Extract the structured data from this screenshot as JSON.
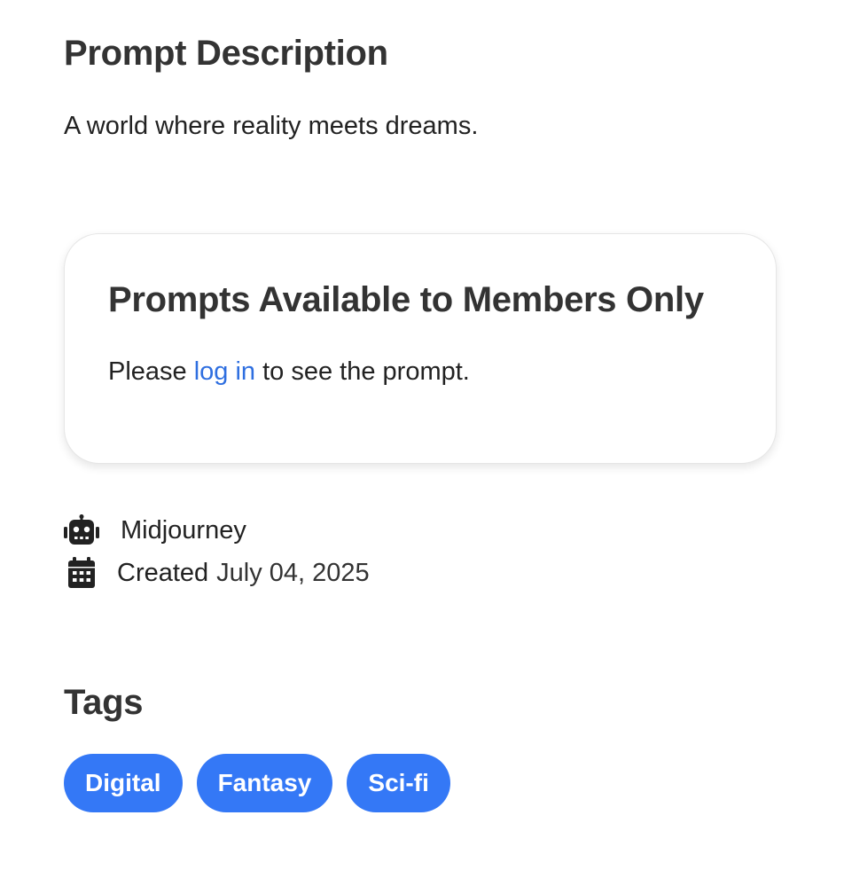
{
  "description": {
    "title": "Prompt Description",
    "text": "A world where reality meets dreams."
  },
  "members_card": {
    "title": "Prompts Available to Members Only",
    "text_before": "Please ",
    "link_label": "log in",
    "text_after": " to see the prompt."
  },
  "meta": {
    "model_icon": "robot-icon",
    "model": "Midjourney",
    "created_icon": "calendar-icon",
    "created_label": "Created",
    "created_date": "July 04, 2025"
  },
  "tags": {
    "title": "Tags",
    "items": [
      "Digital",
      "Fantasy",
      "Sci-fi"
    ]
  },
  "colors": {
    "accent": "#3478f6",
    "link": "#2f6fe0",
    "heading": "#333333"
  }
}
